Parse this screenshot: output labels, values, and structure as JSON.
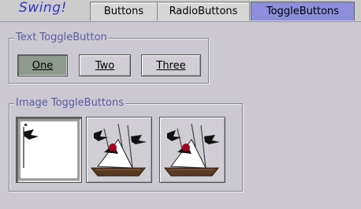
{
  "app": {
    "logo": "Swing!"
  },
  "tabs": [
    {
      "label": "Buttons",
      "selected": false
    },
    {
      "label": "RadioButtons",
      "selected": false
    },
    {
      "label": "ToggleButtons",
      "selected": true
    }
  ],
  "text_group": {
    "title": "Text ToggleButton",
    "buttons": [
      {
        "label": "One",
        "selected": true
      },
      {
        "label": "Two",
        "selected": false
      },
      {
        "label": "Three",
        "selected": false
      }
    ]
  },
  "image_group": {
    "title": "Image ToggleButtons",
    "buttons": [
      {
        "icon": "duke-icon",
        "selected": true
      },
      {
        "icon": "duke-icon",
        "selected": false
      },
      {
        "icon": "duke-icon",
        "selected": false
      }
    ]
  },
  "colors": {
    "selected_tab": "#8c8fdc",
    "group_title": "#5a5aa0",
    "logo": "#3333cc",
    "selected_toggle": "#8f9a8e"
  }
}
